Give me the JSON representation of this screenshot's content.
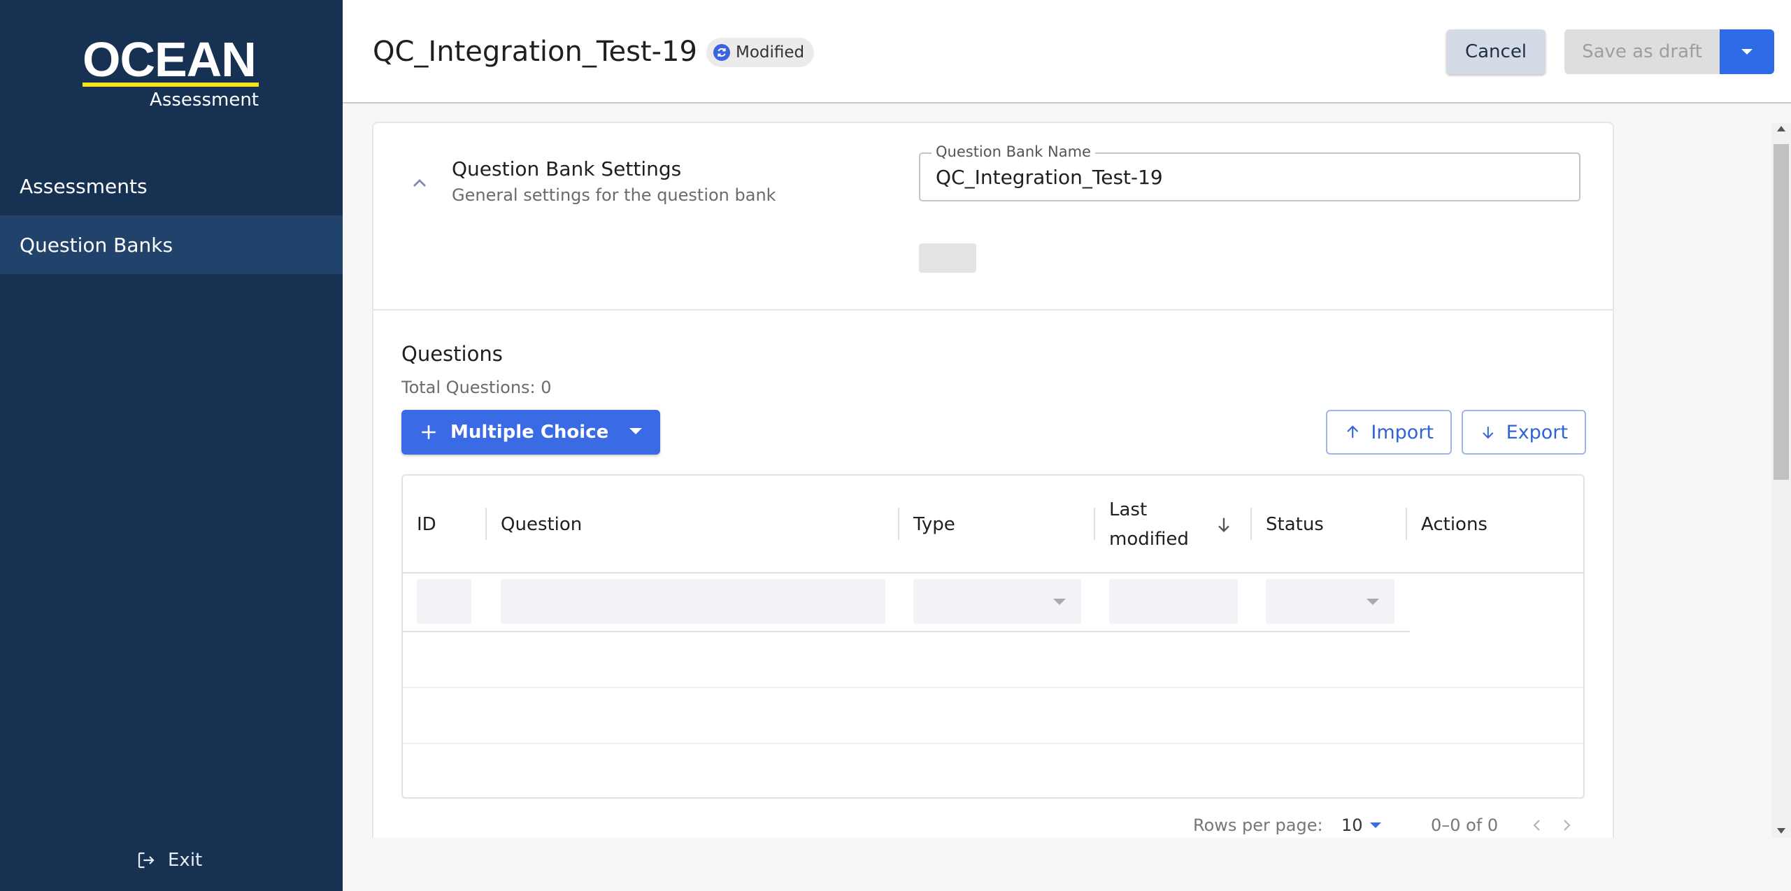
{
  "brand": {
    "word": "OCEAN",
    "sub": "Assessment",
    "accent": "#f4e21b",
    "sidebar_bg": "#163152"
  },
  "sidebar": {
    "items": [
      {
        "label": "Assessments",
        "active": false
      },
      {
        "label": "Question Banks",
        "active": true
      }
    ],
    "exit_label": "Exit"
  },
  "header": {
    "title": "QC_Integration_Test-19",
    "status": "Modified",
    "cancel_label": "Cancel",
    "save_draft_label": "Save as draft",
    "primary_color": "#2f6be6"
  },
  "settings": {
    "title": "Question Bank Settings",
    "subtitle": "General settings for the question bank",
    "name_label": "Question Bank Name",
    "name_value": "QC_Integration_Test-19"
  },
  "questions": {
    "title": "Questions",
    "total": "Total Questions: 0",
    "add_label": "Multiple Choice",
    "import_label": "Import",
    "export_label": "Export"
  },
  "table": {
    "columns": [
      "ID",
      "Question",
      "Type",
      "Last modified",
      "Status",
      "Actions"
    ],
    "sort_column": "Last modified",
    "sort_direction": "descending",
    "rows": []
  },
  "pagination": {
    "rows_per_page_label": "Rows per page:",
    "rows_per_page": "10",
    "range": "0–0 of 0"
  }
}
